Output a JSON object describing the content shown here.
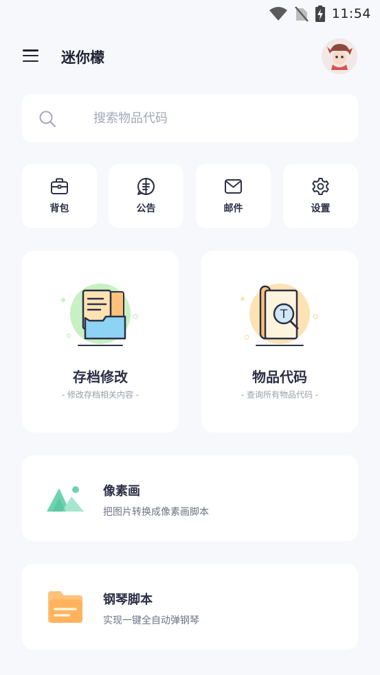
{
  "status_bar": {
    "time": "11:54",
    "icons": [
      "wifi-icon",
      "no-sim-icon",
      "battery-charging-icon"
    ]
  },
  "header": {
    "title": "迷你檬",
    "menu_icon": "hamburger-menu-icon",
    "avatar_icon": "user-avatar"
  },
  "search": {
    "placeholder": "搜索物品代码",
    "value": ""
  },
  "quick_actions": [
    {
      "label": "背包",
      "icon": "backpack-icon"
    },
    {
      "label": "公告",
      "icon": "announcement-icon"
    },
    {
      "label": "邮件",
      "icon": "mail-icon"
    },
    {
      "label": "设置",
      "icon": "settings-icon"
    }
  ],
  "feature_cards": [
    {
      "title": "存档修改",
      "subtitle": "- 修改存档相关内容 -",
      "icon": "save-folder-illustration",
      "accent": "#c8f0c4"
    },
    {
      "title": "物品代码",
      "subtitle": "- 查询所有物品代码 -",
      "icon": "code-book-illustration",
      "accent": "#fde3b4"
    }
  ],
  "list_cards": [
    {
      "title": "像素画",
      "subtitle": "把图片转换成像素画脚本",
      "icon": "mountain-image-icon",
      "accent": "#6ed3b0"
    },
    {
      "title": "钢琴脚本",
      "subtitle": "实现一键全自动弹钢琴",
      "icon": "folder-icon",
      "accent": "#ffc27a"
    }
  ],
  "colors": {
    "background": "#f7f8fb",
    "card": "#ffffff",
    "text": "#2c2f45",
    "muted": "#9a9daa"
  }
}
